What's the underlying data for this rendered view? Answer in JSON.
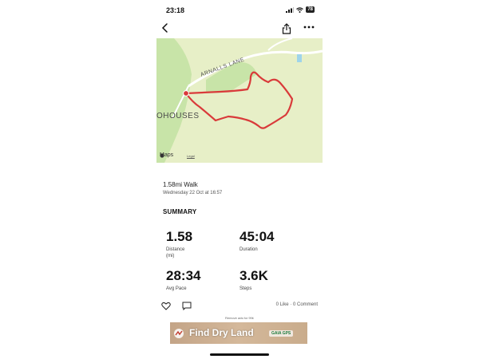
{
  "status_bar": {
    "time": "23:18",
    "battery": "78"
  },
  "map": {
    "road_label": "ARNALLS LANE",
    "place_label": "OHOUSES",
    "attribution": "Maps",
    "legal": "Legal",
    "route_color": "#d93a3a",
    "land_color": "#e7efc7",
    "park_color": "#c8e4a8"
  },
  "activity": {
    "title": "1.58mi Walk",
    "date": "Wednesday 22 Oct at 16:57"
  },
  "summary": {
    "heading": "SUMMARY",
    "metrics": [
      {
        "value": "1.58",
        "label": "Distance",
        "sublabel": "(mi)"
      },
      {
        "value": "45:04",
        "label": "Duration",
        "sublabel": ""
      },
      {
        "value": "28:34",
        "label": "Avg Pace",
        "sublabel": ""
      },
      {
        "value": "3.6K",
        "label": "Steps",
        "sublabel": ""
      }
    ]
  },
  "social": {
    "likes": "0 Like",
    "comments": "0 Comment"
  },
  "ad": {
    "label": "Remove ads for 99¢",
    "headline": "Find Dry Land",
    "brand": "GAIA GPS"
  },
  "icons": {
    "back": "chevron-left-icon",
    "share": "share-icon",
    "more": "more-horizontal-icon",
    "like": "heart-icon",
    "comment": "comment-icon"
  }
}
